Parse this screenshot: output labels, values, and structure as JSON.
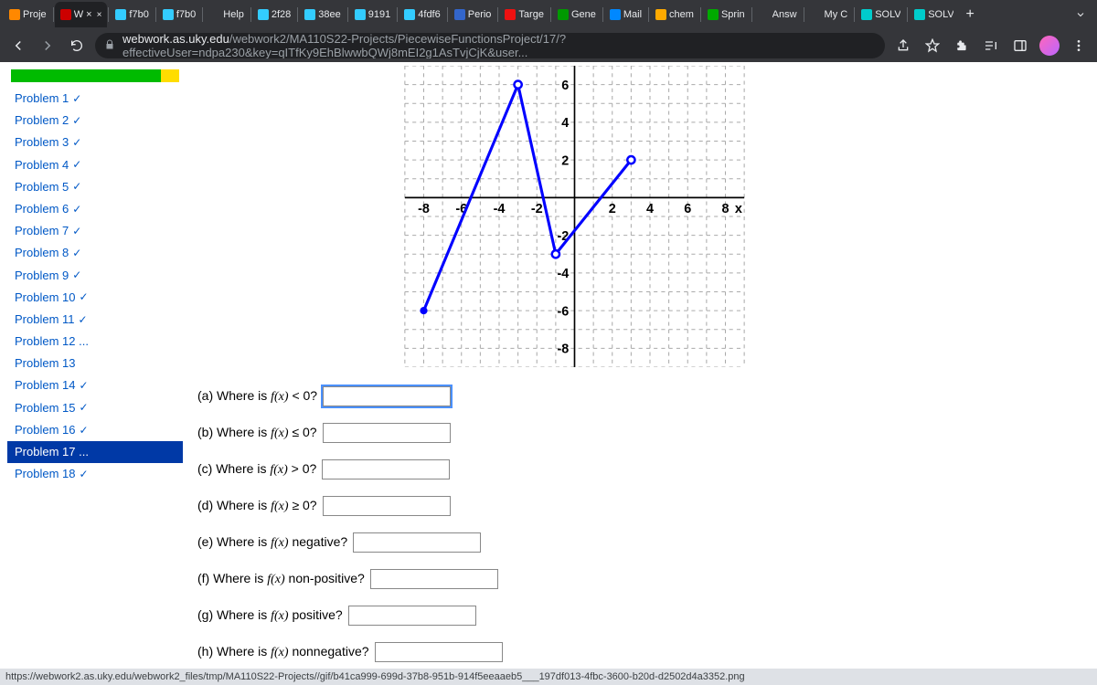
{
  "browser": {
    "tabs": [
      {
        "label": "Proje",
        "icon": "#f80"
      },
      {
        "label": "W ×",
        "icon": "#c00",
        "close": true
      },
      {
        "label": "f7b0",
        "icon": "#3cf"
      },
      {
        "label": "f7b0",
        "icon": "#3cf"
      },
      {
        "label": "Help",
        "icon": ""
      },
      {
        "label": "2f28",
        "icon": "#3cf"
      },
      {
        "label": "38ee",
        "icon": "#3cf"
      },
      {
        "label": "9191",
        "icon": "#3cf"
      },
      {
        "label": "4fdf6",
        "icon": "#3cf"
      },
      {
        "label": "Perio",
        "icon": "#36c"
      },
      {
        "label": "Targe",
        "icon": "#e11"
      },
      {
        "label": "Gene",
        "icon": "#090"
      },
      {
        "label": "Mail",
        "icon": "#08f"
      },
      {
        "label": "chem",
        "icon": "#fa0"
      },
      {
        "label": "Sprin",
        "icon": "#0a0"
      },
      {
        "label": "Answ",
        "icon": ""
      },
      {
        "label": "My C",
        "icon": ""
      },
      {
        "label": "SOLV",
        "icon": "#0cc"
      },
      {
        "label": "SOLV",
        "icon": "#0cc"
      }
    ],
    "url_host": "webwork.as.uky.edu",
    "url_path": "/webwork2/MA110S22-Projects/PiecewiseFunctionsProject/17/?effectiveUser=ndpa230&key=qITfKy9EhBlwwbQWj8mEI2g1AsTvjCjK&user..."
  },
  "sidebar": {
    "items": [
      {
        "label": "Problem 1",
        "check": true
      },
      {
        "label": "Problem 2",
        "check": true
      },
      {
        "label": "Problem 3",
        "check": true
      },
      {
        "label": "Problem 4",
        "check": true
      },
      {
        "label": "Problem 5",
        "check": true
      },
      {
        "label": "Problem 6",
        "check": true
      },
      {
        "label": "Problem 7",
        "check": true
      },
      {
        "label": "Problem 8",
        "check": true
      },
      {
        "label": "Problem 9",
        "check": true
      },
      {
        "label": "Problem 10",
        "check": true
      },
      {
        "label": "Problem 11",
        "check": true
      },
      {
        "label": "Problem 12 ...",
        "check": false
      },
      {
        "label": "Problem 13",
        "check": false
      },
      {
        "label": "Problem 14",
        "check": true
      },
      {
        "label": "Problem 15",
        "check": true
      },
      {
        "label": "Problem 16",
        "check": true
      },
      {
        "label": "Problem 17 ...",
        "check": false,
        "selected": true
      },
      {
        "label": "Problem 18",
        "check": true
      }
    ]
  },
  "graph": {
    "xticks": [
      "-8",
      "-6",
      "-4",
      "-2",
      "2",
      "4",
      "6",
      "8",
      "x"
    ],
    "yticks": [
      "6",
      "4",
      "2",
      "-2",
      "-4",
      "-6",
      "-8"
    ]
  },
  "questions": {
    "a": "(a) Where is ",
    "a2": " < 0?",
    "b": "(b) Where is ",
    "b2": " ≤ 0?",
    "c": "(c) Where is ",
    "c2": " > 0?",
    "d": "(d) Where is ",
    "d2": " ≥ 0?",
    "e": "(e) Where is ",
    "e2": " negative?",
    "f": "(f) Where is ",
    "f2": " non-positive?",
    "g": "(g) Where is ",
    "g2": " positive?",
    "h": "(h) Where is ",
    "h2": " nonnegative?",
    "fx": "f(x)"
  },
  "status": "https://webwork2.as.uky.edu/webwork2_files/tmp/MA110S22-Projects//gif/b41ca999-699d-37b8-951b-914f5eeaaeb5___197df013-4fbc-3600-b20d-d2502d4a3352.png",
  "chart_data": {
    "type": "line",
    "title": "",
    "xlabel": "x",
    "ylabel": "",
    "xlim": [
      -9,
      9
    ],
    "ylim": [
      -9,
      7
    ],
    "segments": [
      {
        "points": [
          [
            -8,
            -6
          ],
          [
            -3,
            6
          ]
        ],
        "left_endpoint": "closed",
        "right_endpoint": "open"
      },
      {
        "points": [
          [
            -3,
            6
          ],
          [
            -1,
            -3
          ]
        ],
        "left_endpoint": "open",
        "right_endpoint": "open"
      },
      {
        "points": [
          [
            -1,
            -3
          ],
          [
            3,
            2
          ]
        ],
        "left_endpoint": "open",
        "right_endpoint": "open"
      }
    ],
    "grid": true
  }
}
